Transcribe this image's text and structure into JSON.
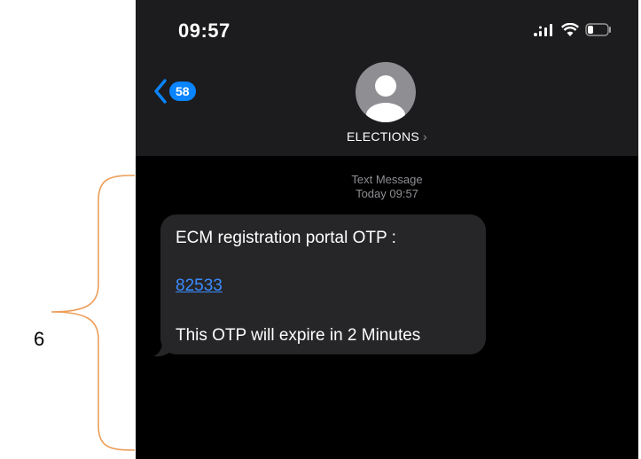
{
  "annotation": {
    "number": "6",
    "bracket_color": "#ED9E5A"
  },
  "status_bar": {
    "time": "09:57",
    "icons": [
      "signal-icon",
      "wifi-icon",
      "battery-icon"
    ]
  },
  "header": {
    "back_count": "58",
    "contact_name": "ELECTIONS",
    "chevron": "›"
  },
  "message": {
    "type": "Text Message",
    "timestamp": "Today 09:57",
    "line1": "ECM registration portal OTP :",
    "otp": "82533",
    "line3": "This OTP will expire in 2 Minutes"
  },
  "colors": {
    "accent": "#0a84ff",
    "link": "#3b8cff",
    "bubble": "#262628",
    "header_bg": "#1c1c1e"
  }
}
